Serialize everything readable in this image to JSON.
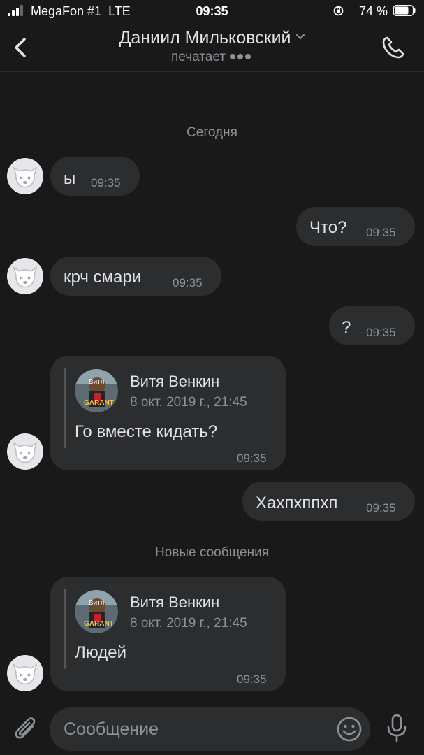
{
  "status_bar": {
    "carrier": "MegaFon #1",
    "network": "LTE",
    "time": "09:35",
    "battery": "74 %"
  },
  "header": {
    "contact_name": "Даниил Мильковский",
    "status": "печатает"
  },
  "chat": {
    "date_separator": "Сегодня",
    "new_messages_separator": "Новые сообщения",
    "messages": [
      {
        "text": "ы",
        "time": "09:35"
      },
      {
        "text": "Что?",
        "time": "09:35"
      },
      {
        "text": "крч смари",
        "time": "09:35"
      },
      {
        "text": "?",
        "time": "09:35"
      },
      {
        "fwd_name": "Витя Венкин",
        "fwd_date": "8 окт. 2019 г., 21:45",
        "fwd_avatar_text": [
          "Витя",
          "GARANT"
        ],
        "text": "Го вместе кидать?",
        "time": "09:35"
      },
      {
        "text": "Хахпхппхп",
        "time": "09:35"
      },
      {
        "fwd_name": "Витя Венкин",
        "fwd_date": "8 окт. 2019 г., 21:45",
        "fwd_avatar_text": [
          "Витя",
          "GARANT"
        ],
        "text": "Людей",
        "time": "09:35"
      }
    ]
  },
  "composer": {
    "placeholder": "Сообщение"
  },
  "icons": {
    "back": "chevron-left-icon",
    "call": "phone-icon",
    "attach": "paperclip-icon",
    "emoji": "smile-icon",
    "voice": "microphone-icon"
  },
  "colors": {
    "background": "#19191a",
    "bubble": "#2c2d2e",
    "text": "#e1e3e6",
    "secondary": "#8d9299"
  }
}
